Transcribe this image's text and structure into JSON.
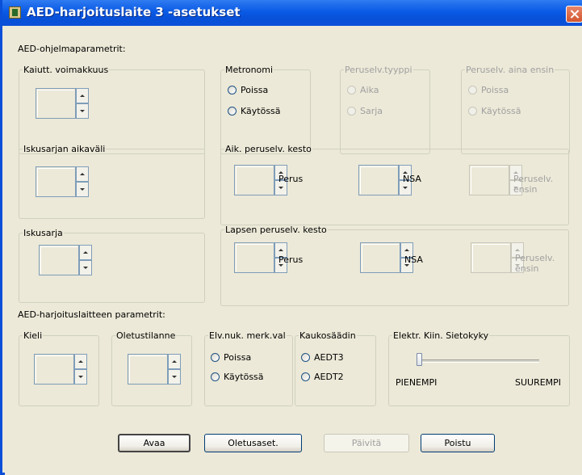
{
  "window": {
    "title": "AED-harjoituslaite 3 -asetukset"
  },
  "program_params": {
    "heading": "AED-ohjelmaparametrit:",
    "kaiutt": {
      "label": "Kaiutt. voimakkuus"
    },
    "metronomi": {
      "label": "Metronomi",
      "options": [
        "Poissa",
        "Käytössä"
      ]
    },
    "peruselv_tyyppi": {
      "label": "Peruselv.tyyppi",
      "options": [
        "Aika",
        "Sarja"
      ]
    },
    "peruselv_aina": {
      "label": "Peruselv. aina ensin",
      "options": [
        "Poissa",
        "Käytössä"
      ]
    },
    "iskusarjan": {
      "label": "Iskusarjan aikaväli"
    },
    "aik_peruselv": {
      "label": "Aik. peruselv. kesto",
      "perus": "Perus",
      "nsa": "NSA",
      "peruselv_ensin": "Peruselv. ensin"
    },
    "iskusarja": {
      "label": "Iskusarja"
    },
    "lapsen_peruselv": {
      "label": "Lapsen peruselv. kesto",
      "perus": "Perus",
      "nsa": "NSA",
      "peruselv_ensin": "Peruselv. ensin"
    }
  },
  "device_params": {
    "heading": "AED-harjoituslaitteen parametrit:",
    "kieli": {
      "label": "Kieli"
    },
    "oletustilanne": {
      "label": "Oletustilanne"
    },
    "elv_nuk": {
      "label": "Elv.nuk. merk.val",
      "options": [
        "Poissa",
        "Käytössä"
      ]
    },
    "kaukosaadin": {
      "label": "Kaukosäädin",
      "options": [
        "AEDT3",
        "AEDT2"
      ]
    },
    "elektr": {
      "label": "Elektr. Kiin. Sietokyky",
      "min_label": "PIENEMPI",
      "max_label": "SUUREMPI",
      "level_fraction": 0
    }
  },
  "buttons": {
    "avaa": "Avaa",
    "oletusaset": "Oletusaset.",
    "paivita": "Päivitä",
    "poistu": "Poistu"
  },
  "colors": {
    "titlebar": "#0a5ae6",
    "dialog_bg": "#ECE9D8",
    "disabled_text": "#a0a0a0"
  }
}
